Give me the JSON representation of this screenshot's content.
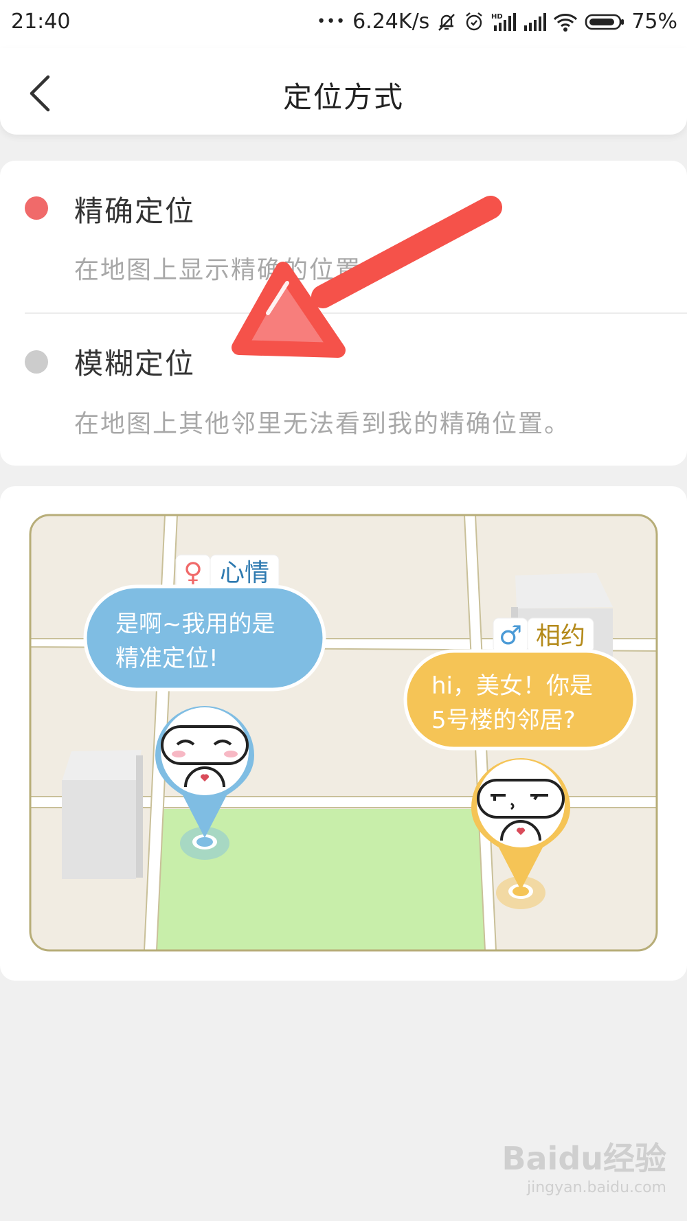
{
  "status_bar": {
    "time": "21:40",
    "dots": "•••",
    "net_speed": "6.24K/s",
    "battery": "75%",
    "icons": [
      "bell-off-icon",
      "alarm-icon",
      "hd-signal-icon",
      "signal-icon",
      "wifi-icon",
      "battery-icon"
    ]
  },
  "nav": {
    "back_icon": "chevron-left-icon",
    "title": "定位方式"
  },
  "options": [
    {
      "title": "精确定位",
      "desc": "在地图上显示精确的位置。",
      "color": "#f06a6a"
    },
    {
      "title": "模糊定位",
      "desc": "在地图上其他邻里无法看到我的精确位置。",
      "color": "#cccccc"
    }
  ],
  "illustration": {
    "left_badge": {
      "gender_symbol": "♀",
      "label": "心情"
    },
    "left_bubble": {
      "line1": "是啊~我用的是",
      "line2": "精准定位!"
    },
    "right_badge": {
      "gender_symbol": "♂",
      "label": "相约"
    },
    "right_bubble": {
      "line1": "hi，美女！你是",
      "line2": "5号楼的邻居?"
    },
    "colors": {
      "blue": "#7fbde3",
      "yellow": "#f5c456",
      "park": "#c8eeaa",
      "ground": "#f1ece2"
    }
  },
  "annotation": {
    "color": "#f5524a"
  },
  "watermark": {
    "brand": "Baidu经验",
    "url": "jingyan.baidu.com"
  }
}
